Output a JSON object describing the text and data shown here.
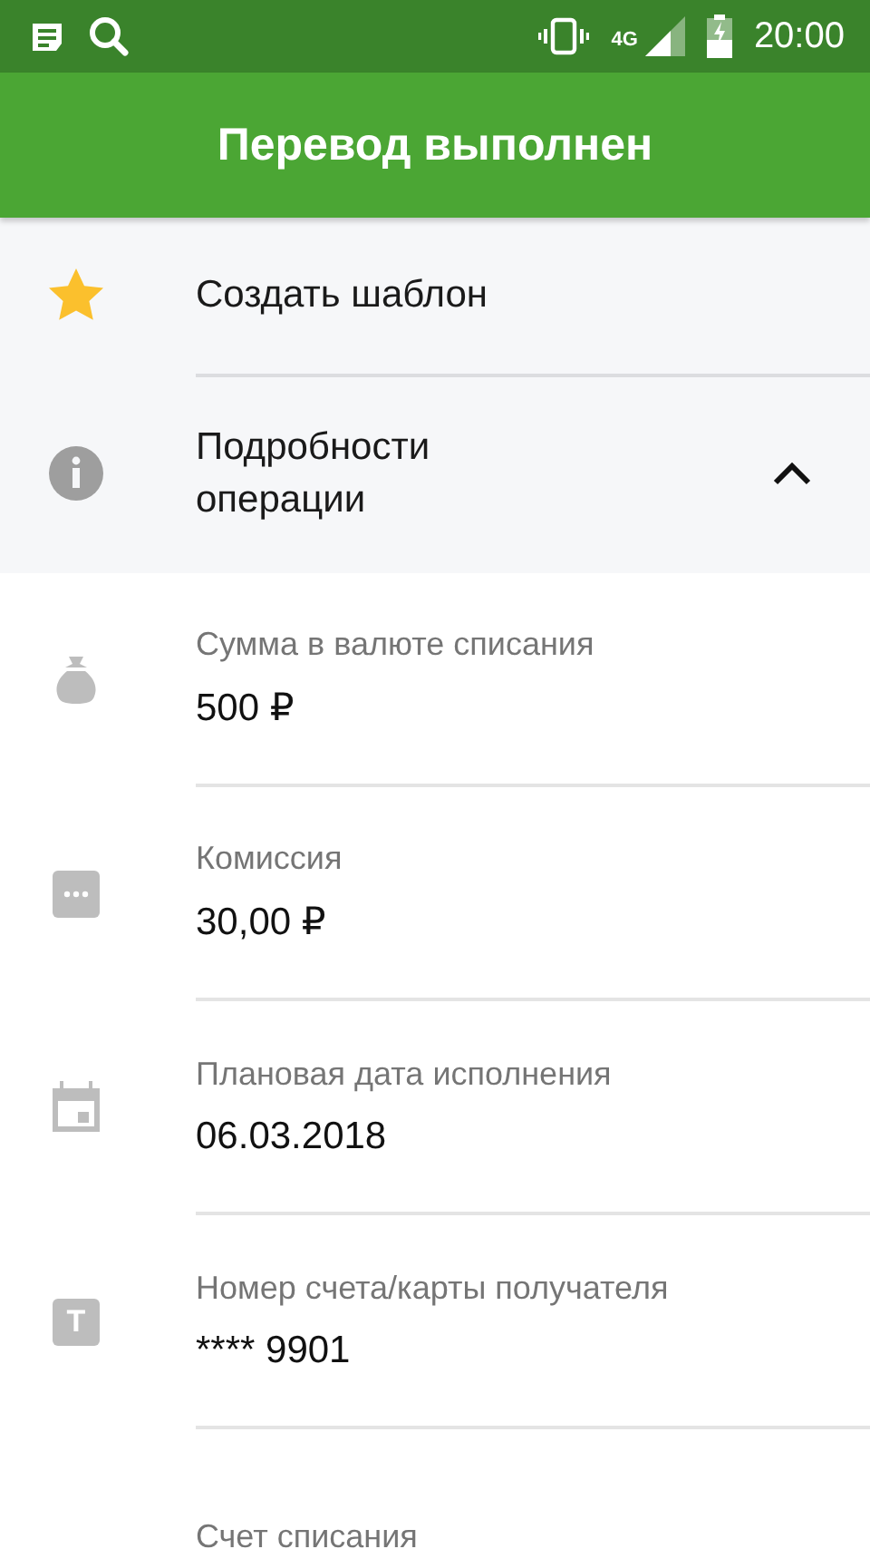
{
  "status_bar": {
    "time": "20:00",
    "network": "4G"
  },
  "app_bar": {
    "title": "Перевод выполнен"
  },
  "actions": [
    {
      "kind": "star",
      "label": "Создать шаблон"
    },
    {
      "kind": "info",
      "label": "Подробности\nоперации",
      "expanded": true
    }
  ],
  "details": [
    {
      "kind": "bag",
      "label": "Сумма в валюте списания",
      "value": "500 ₽"
    },
    {
      "kind": "dots",
      "label": "Комиссия",
      "value": "30,00 ₽"
    },
    {
      "kind": "calendar",
      "label": "Плановая дата исполнения",
      "value": "06.03.2018"
    },
    {
      "kind": "letter",
      "icon_text": "T",
      "label": "Номер счета/карты получателя",
      "value": "**** 9901"
    },
    {
      "kind": "none",
      "label": "Счет списания"
    }
  ]
}
